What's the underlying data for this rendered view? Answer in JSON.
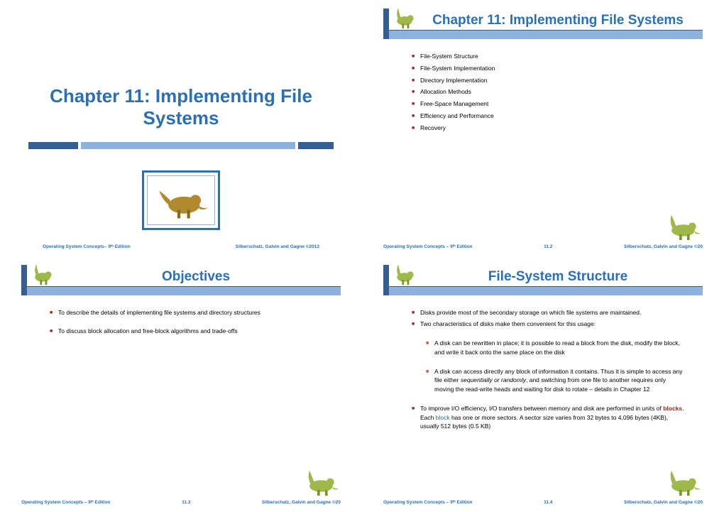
{
  "slide1": {
    "title": "Chapter 11:  Implementing File Systems",
    "footer_left": "Operating System Concepts– 9ᵗʰ Edition",
    "footer_right": "Silberschatz, Galvin and Gagne ©2013"
  },
  "slide2": {
    "title": "Chapter 11: Implementing File Systems",
    "items": [
      "File-System Structure",
      "File-System Implementation",
      "Directory Implementation",
      "Allocation Methods",
      "Free-Space Management",
      "Efficiency and Performance",
      "Recovery"
    ],
    "footer_left": "Operating System Concepts  – 9ᵗʰ Edition",
    "slide_num": "11.2",
    "footer_right": "Silberschatz, Galvin and Gagne ©20"
  },
  "slide3": {
    "title": "Objectives",
    "item1": "To describe the details of implementing file systems and directory structures",
    "item2": "To discuss block allocation and free-block algorithms and trade-offs",
    "footer_left": "Operating System Concepts  – 9ᵗʰ Edition",
    "slide_num": "11.3",
    "footer_right": "Silberschatz, Galvin and Gagne ©20"
  },
  "slide4": {
    "title": "File-System Structure",
    "item1": "Disks provide most of the secondary storage on which file systems are maintained.",
    "item2": "Two characteristics of disks make them convenient for this usage:",
    "sub1": "A disk can be rewritten in place; it is possible to read a block from the disk, modify the block, and write it back onto the same place on the disk",
    "sub2_a": "A disk can access directly any block of information it contains. Thus it is simple to access any file either ",
    "sub2_b": "sequentially or randomly",
    "sub2_c": ", and switching from one file to another requires only moving the read-write heads and waiting for disk to rotate – details in Chapter 12",
    "item3_a": "To improve I/O efficiency, I/O transfers between memory and disk are performed in units of ",
    "item3_b": "blocks",
    "item3_c": ". Each ",
    "item3_d": "block",
    "item3_e": " has one or more sectors. A sector size varies from 32 bytes to 4,096 bytes (4KB), usually 512 bytes (0.5 KB)",
    "footer_left": "Operating System Concepts  – 9ᵗʰ Edition",
    "slide_num": "11.4",
    "footer_right": "Silberschatz, Galvin and Gagne ©20"
  }
}
